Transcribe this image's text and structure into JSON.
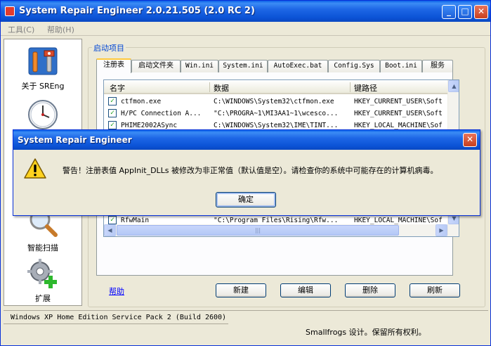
{
  "window": {
    "title": "System Repair Engineer 2.0.21.505 (2.0 RC 2)",
    "minimize_glyph": "_",
    "maximize_glyph": "□",
    "close_glyph": "✕"
  },
  "menu": {
    "items": [
      {
        "label": "工具(C)"
      },
      {
        "label": "帮助(H)"
      }
    ]
  },
  "sidebar": {
    "items": [
      {
        "label": "关于 SREng",
        "icon": "tools-icon"
      },
      {
        "label": "",
        "icon": "clock-icon"
      },
      {
        "label": "智能扫描",
        "icon": "magnifier-icon"
      },
      {
        "label": "扩展",
        "icon": "gear-plus-icon"
      }
    ]
  },
  "group": {
    "title": "启动项目"
  },
  "tabs": [
    {
      "label": "注册表",
      "active": true
    },
    {
      "label": "启动文件夹"
    },
    {
      "label": "Win.ini"
    },
    {
      "label": "System.ini"
    },
    {
      "label": "AutoExec.bat"
    },
    {
      "label": "Config.Sys"
    },
    {
      "label": "Boot.ini"
    },
    {
      "label": "服务"
    }
  ],
  "table": {
    "columns": [
      "名字",
      "数据",
      "键路径"
    ],
    "rows": [
      {
        "name": "ctfmon.exe",
        "data": "C:\\WINDOWS\\System32\\ctfmon.exe",
        "key": "HKEY_CURRENT_USER\\Soft",
        "checked": true
      },
      {
        "name": "H/PC Connection A...",
        "data": "\"C:\\PROGRA~1\\MI3AA1~1\\wcesco...",
        "key": "HKEY_CURRENT_USER\\Soft",
        "checked": true
      },
      {
        "name": "PHIME2002ASync",
        "data": "C:\\WINDOWS\\System32\\IME\\TINT...",
        "key": "HKEY_LOCAL_MACHINE\\Sof",
        "checked": true
      },
      {
        "name": "RfwMain",
        "data": "\"C:\\Program Files\\Rising\\Rfw...",
        "key": "HKEY_LOCAL_MACHINE\\Sof",
        "checked": true
      }
    ]
  },
  "scroll": {
    "up": "▲",
    "down": "▼",
    "left": "◀",
    "right": "▶",
    "grip": "|||"
  },
  "actions": {
    "help": "帮助",
    "new": "新建",
    "edit": "编辑",
    "delete": "删除",
    "refresh": "刷新"
  },
  "status": {
    "os": "Windows XP Home Edition Service Pack 2 (Build 2600)",
    "credit": "Smallfrogs 设计。保留所有权利。"
  },
  "dialog": {
    "title": "System Repair Engineer",
    "close_glyph": "✕",
    "message": "警告！注册表值 AppInit_DLLs 被修改为非正常值（默认值是空）。请检查你的系统中可能存在的计算机病毒。",
    "ok": "确定",
    "icon": "warning-icon"
  },
  "colors": {
    "titlebar": "#0B53D6",
    "link": "#0000FF",
    "group_title": "#0046D5",
    "check": "#21A121"
  }
}
